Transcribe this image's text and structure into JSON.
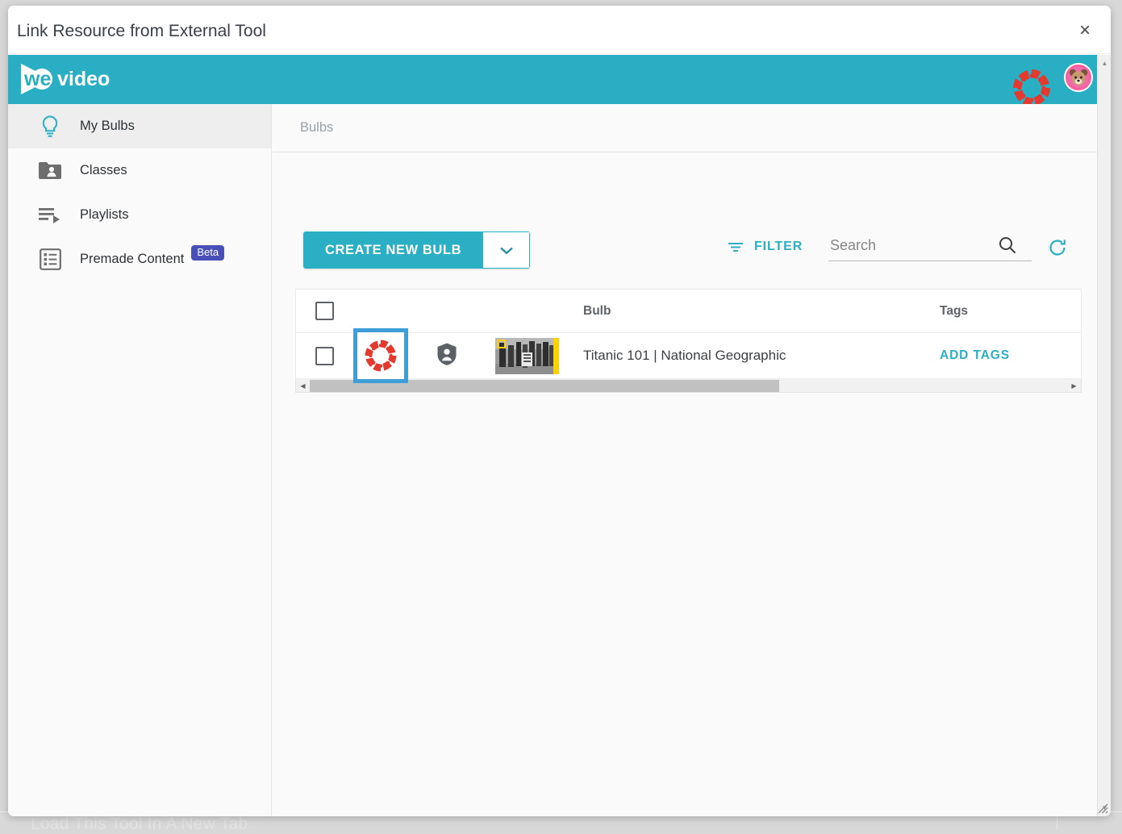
{
  "background": {
    "hidden_link_label": "Load This Tool In A New Tab"
  },
  "modal": {
    "title": "Link Resource from External Tool",
    "close_label": "×",
    "close_icon": "close-icon"
  },
  "appbar": {
    "logo_text": "wevideo",
    "canvas_icon": "canvas-logo-icon",
    "avatar_icon": "user-avatar-icon",
    "background_color": "#2aaec4"
  },
  "sidebar": {
    "items": [
      {
        "label": "My Bulbs",
        "icon": "lightbulb-icon",
        "active": true,
        "badge": ""
      },
      {
        "label": "Classes",
        "icon": "folder-person-icon",
        "active": false,
        "badge": ""
      },
      {
        "label": "Playlists",
        "icon": "playlist-play-icon",
        "active": false,
        "badge": ""
      },
      {
        "label": "Premade Content",
        "icon": "list-box-icon",
        "active": false,
        "badge": "Beta"
      }
    ]
  },
  "content": {
    "breadcrumb": "Bulbs",
    "toolbar": {
      "create_label": "CREATE NEW BULB",
      "create_caret_icon": "chevron-down-icon",
      "filter_label": "FILTER",
      "filter_icon": "filter-icon",
      "search_placeholder": "Search",
      "search_value": "",
      "search_icon": "search-icon",
      "refresh_icon": "refresh-icon"
    },
    "table": {
      "columns": {
        "select": "",
        "source": "",
        "privacy": "",
        "thumbnail": "",
        "bulb": "Bulb",
        "tags": "Tags"
      },
      "rows": [
        {
          "selected": false,
          "source_icon": "canvas-logo-icon",
          "source_highlighted": true,
          "privacy_icon": "shield-person-icon",
          "thumbnail_icon": "video-thumbnail",
          "bulb": "Titanic 101 | National Geographic",
          "tags_action": "ADD TAGS"
        }
      ]
    },
    "scrollbar": {
      "left_arrow": "◀",
      "right_arrow": "▶",
      "thumb_percent": "62"
    }
  },
  "colors": {
    "teal": "#2aafc4",
    "beta_badge": "#4850b8",
    "canvas_red": "#e4392e",
    "selection_blue": "#3e9fd8",
    "avatar_pink": "#f95fa0"
  }
}
